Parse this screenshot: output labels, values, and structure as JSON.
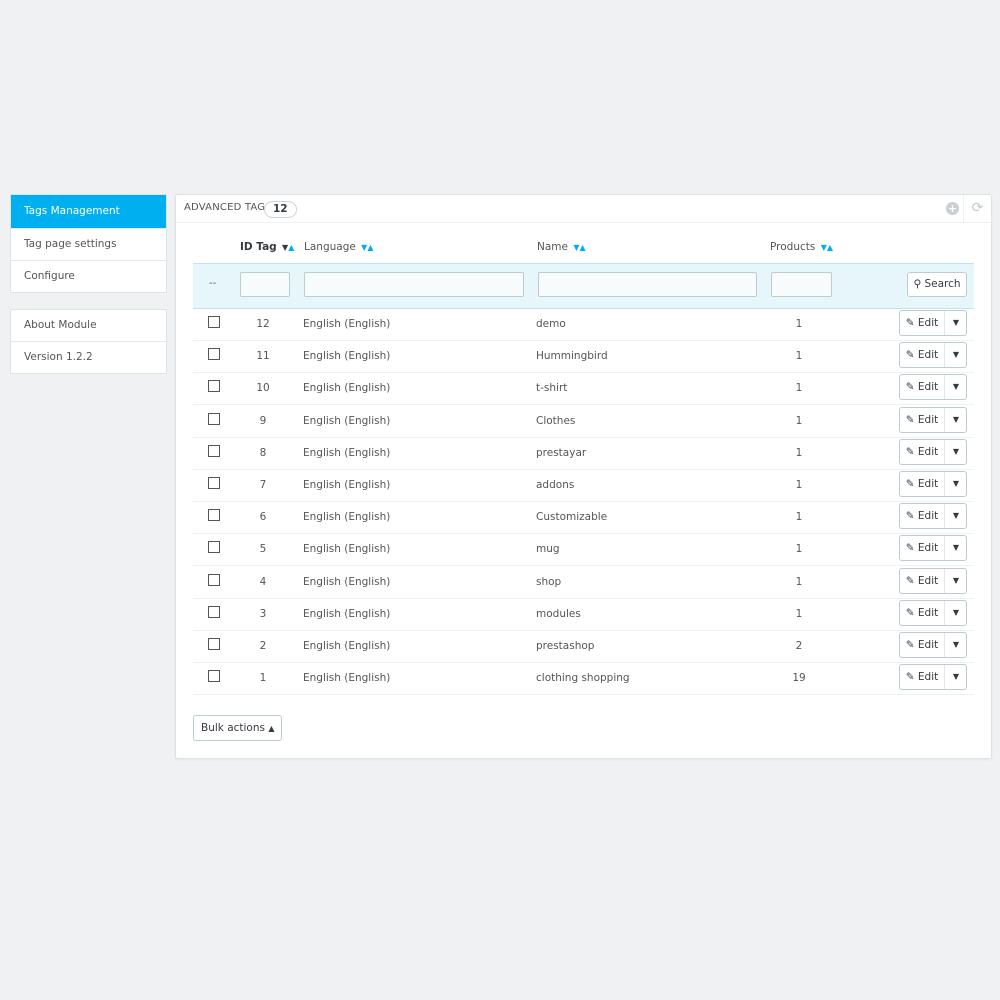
{
  "sidebar": {
    "group1": [
      "Tags Management",
      "Tag page settings",
      "Configure"
    ],
    "group2": [
      "About Module",
      "Version 1.2.2"
    ]
  },
  "panel": {
    "title": "ADVANCED TAGS",
    "count": "12"
  },
  "columns": {
    "id": "ID Tag",
    "language": "Language",
    "name": "Name",
    "products": "Products"
  },
  "filter": {
    "dash": "--",
    "search_label": "Search"
  },
  "rows": [
    {
      "id": "12",
      "language": "English (English)",
      "name": "demo",
      "products": "1"
    },
    {
      "id": "11",
      "language": "English (English)",
      "name": "Hummingbird",
      "products": "1"
    },
    {
      "id": "10",
      "language": "English (English)",
      "name": "t-shirt",
      "products": "1"
    },
    {
      "id": "9",
      "language": "English (English)",
      "name": "Clothes",
      "products": "1"
    },
    {
      "id": "8",
      "language": "English (English)",
      "name": "prestayar",
      "products": "1"
    },
    {
      "id": "7",
      "language": "English (English)",
      "name": "addons",
      "products": "1"
    },
    {
      "id": "6",
      "language": "English (English)",
      "name": "Customizable",
      "products": "1"
    },
    {
      "id": "5",
      "language": "English (English)",
      "name": "mug",
      "products": "1"
    },
    {
      "id": "4",
      "language": "English (English)",
      "name": "shop",
      "products": "1"
    },
    {
      "id": "3",
      "language": "English (English)",
      "name": "modules",
      "products": "1"
    },
    {
      "id": "2",
      "language": "English (English)",
      "name": "prestashop",
      "products": "2"
    },
    {
      "id": "1",
      "language": "English (English)",
      "name": "clothing shopping",
      "products": "19"
    }
  ],
  "actions": {
    "edit_label": "Edit",
    "bulk_label": "Bulk actions"
  },
  "colors": {
    "accent": "#00aff0",
    "filter_bg": "#e7f6fb",
    "page_bg": "#eff1f2"
  },
  "icons": {
    "edit": "pencil-icon",
    "search": "magnifier-icon",
    "add": "plus-circle-icon",
    "refresh": "refresh-icon"
  }
}
